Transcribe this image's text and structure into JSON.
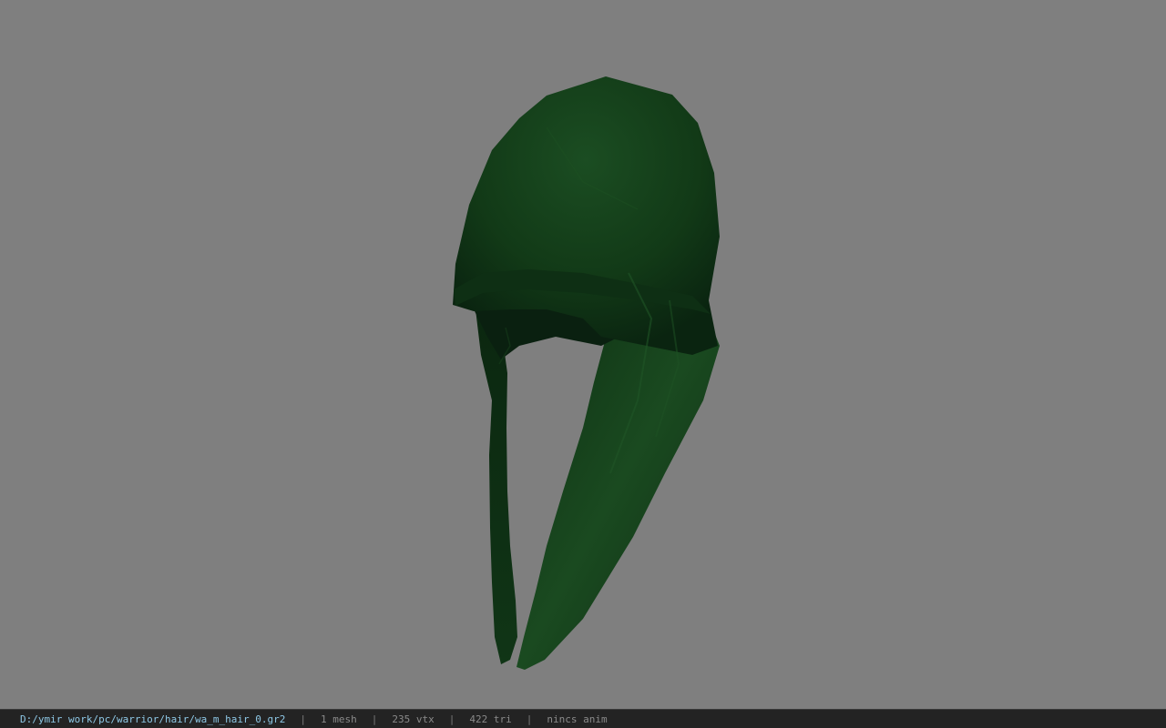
{
  "viewer": {
    "background_color": "#7f7f7f",
    "model_color": "#123d18",
    "model": "green hood hair mesh"
  },
  "status_bar": {
    "file_path": "D:/ymir work/pc/warrior/hair/wa_m_hair_0.gr2",
    "mesh_count": "1 mesh",
    "vertex_count": "235 vtx",
    "triangle_count": "422 tri",
    "animation": "nincs anim",
    "separator": "|"
  }
}
